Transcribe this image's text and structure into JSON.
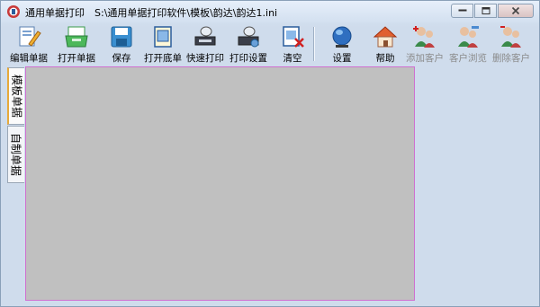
{
  "window": {
    "app_title": "通用单据打印",
    "file_path": "S:\\通用单据打印软件\\模板\\韵达\\韵达1.ini",
    "accent_border": "#d070d0",
    "workspace_color": "#c0c0c0"
  },
  "caption_buttons": [
    "minimize",
    "maximize",
    "close"
  ],
  "toolbar": {
    "items": [
      {
        "label": "编辑单据",
        "icon": "edit-document-icon",
        "enabled": true
      },
      {
        "label": "打开单据",
        "icon": "open-tray-icon",
        "enabled": true
      },
      {
        "label": "保存",
        "icon": "save-disk-icon",
        "enabled": true
      },
      {
        "label": "打开底单",
        "icon": "open-template-icon",
        "enabled": true
      },
      {
        "label": "快速打印",
        "icon": "quick-print-icon",
        "enabled": true
      },
      {
        "label": "打印设置",
        "icon": "print-settings-icon",
        "enabled": true
      },
      {
        "label": "清空",
        "icon": "clear-icon",
        "enabled": true
      },
      {
        "label": "设置",
        "icon": "settings-globe-icon",
        "enabled": true
      },
      {
        "label": "帮助",
        "icon": "help-house-icon",
        "enabled": true
      },
      {
        "label": "添加客户",
        "icon": "add-customer-icon",
        "enabled": false
      },
      {
        "label": "客户浏览",
        "icon": "browse-customers-icon",
        "enabled": false
      },
      {
        "label": "删除客户",
        "icon": "delete-customer-icon",
        "enabled": false
      }
    ]
  },
  "tabs": [
    {
      "label": "模板单据",
      "active": true
    },
    {
      "label": "自制单据",
      "active": false
    }
  ]
}
